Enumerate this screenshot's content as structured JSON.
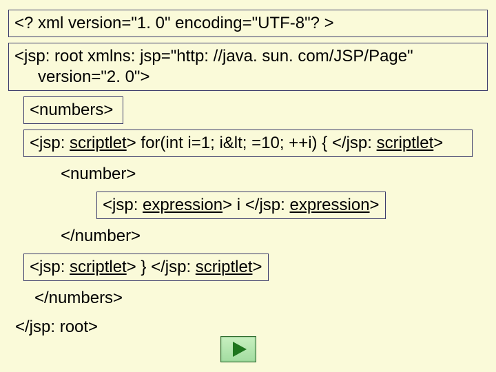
{
  "lines": {
    "xml_decl": "<? xml version=\"1. 0\" encoding=\"UTF-8\"? >",
    "jsp_root_open_1": "<jsp: root xmlns: jsp=\"http: //java. sun. com/JSP/Page\"",
    "jsp_root_open_2": "version=\"2. 0\">",
    "numbers_open": "<numbers>",
    "scriptlet_open_tag": "<jsp: scriptlet>",
    "scriptlet_code_open": " for(int i=1; i&lt; =10; ++i) { ",
    "scriptlet_close_tag": "</jsp: scriptlet>",
    "number_open": "<number>",
    "expression_open_tag": "<jsp: expression>",
    "expression_content": " i ",
    "expression_close_tag": "</jsp: expression>",
    "number_close": "</number>",
    "scriptlet_code_close": " } ",
    "numbers_close": "</numbers>",
    "jsp_root_close": "</jsp: root>"
  },
  "colors": {
    "bg": "#fafad9",
    "border": "#3a3a6a",
    "play_fill": "#a2dca0",
    "play_border": "#2d6b2d"
  }
}
